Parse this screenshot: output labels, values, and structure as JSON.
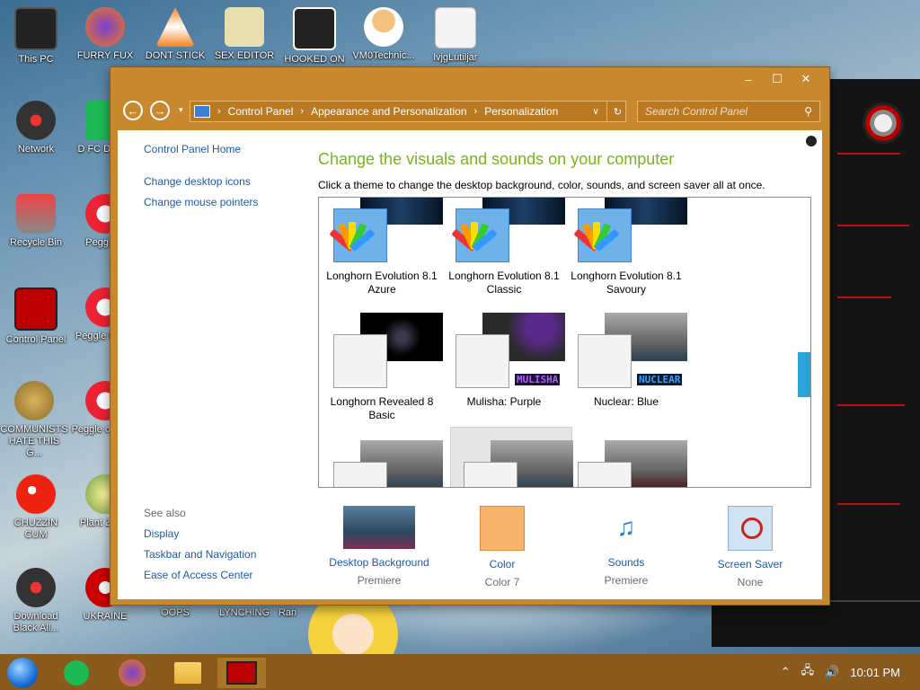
{
  "desktop": {
    "icons": [
      {
        "label": "This PC"
      },
      {
        "label": "FURRY FUX"
      },
      {
        "label": "DONT STICK"
      },
      {
        "label": "SEX EDITOR"
      },
      {
        "label": "HOOKED ON"
      },
      {
        "label": "VM0Technic..."
      },
      {
        "label": "lvjgLutiljar"
      },
      {
        "label": "Network"
      },
      {
        "label": "D FC DUME"
      },
      {
        "label": "Recycle Bin"
      },
      {
        "label": "Peggle L"
      },
      {
        "label": "Control Panel"
      },
      {
        "label": "Peggle I Delu"
      },
      {
        "label": "COMMUNISTS HATE THIS G..."
      },
      {
        "label": "Peggle of Warc"
      },
      {
        "label": "CHUZZIN CUM"
      },
      {
        "label": "Plant Zomb"
      },
      {
        "label": "Download Black All..."
      },
      {
        "label": "UKRAINE"
      },
      {
        "label": "OOPS"
      },
      {
        "label": "LYNCHING"
      },
      {
        "label": "Ran"
      }
    ]
  },
  "window": {
    "controls": {
      "minimize": "–",
      "maximize": "☐",
      "close": "✕"
    },
    "nav": {
      "back": "←",
      "forward": "→",
      "recent": "▾"
    },
    "breadcrumb": [
      "Control Panel",
      "Appearance and Personalization",
      "Personalization"
    ],
    "search": {
      "placeholder": "Search Control Panel"
    },
    "left_pane": {
      "home": "Control Panel Home",
      "links": [
        "Change desktop icons",
        "Change mouse pointers"
      ],
      "see_also_title": "See also",
      "see_also": [
        "Display",
        "Taskbar and Navigation",
        "Ease of Access Center"
      ]
    },
    "heading": "Change the visuals and sounds on your computer",
    "subtext": "Click a theme to change the desktop background, color, sounds, and screen saver all at once.",
    "themes": [
      {
        "name": "Longhorn Evolution 8.1 Azure"
      },
      {
        "name": "Longhorn Evolution 8.1 Classic"
      },
      {
        "name": "Longhorn Evolution 8.1 Savoury"
      },
      {
        "name": "Longhorn Revealed 8 Basic"
      },
      {
        "name": "Mulisha: Purple",
        "tag": "MULISHA"
      },
      {
        "name": "Nuclear: Blue",
        "tag": "NUCLEAR"
      },
      {
        "name": ""
      },
      {
        "name": ""
      },
      {
        "name": ""
      }
    ],
    "bottom": [
      {
        "link": "Desktop Background",
        "value": "Premiere"
      },
      {
        "link": "Color",
        "value": "Color 7"
      },
      {
        "link": "Sounds",
        "value": "Premiere"
      },
      {
        "link": "Screen Saver",
        "value": "None"
      }
    ]
  },
  "taskbar": {
    "time": "10:01 PM"
  },
  "colors": {
    "window_frame": "#c8882e",
    "link": "#1e5aa8",
    "heading": "#78b51c",
    "taskbar": "#8a5a1c"
  }
}
